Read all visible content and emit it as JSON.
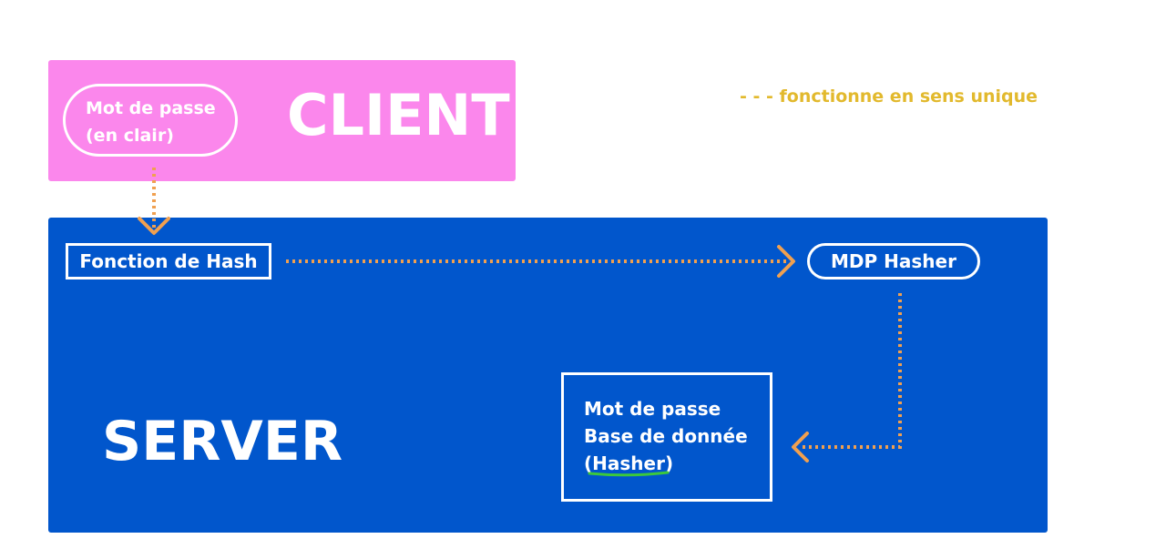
{
  "client": {
    "title": "CLIENT",
    "password_line1": "Mot de passe",
    "password_line2": "(en clair)"
  },
  "server": {
    "title": "SERVER",
    "hash_function": "Fonction de Hash",
    "hashed_password": "MDP Hasher",
    "database_line1": "Mot de passe",
    "database_line2": "Base de donnée",
    "database_line3": "(Hasher)"
  },
  "legend": {
    "text": "- - - fonctionne en sens unique"
  },
  "colors": {
    "client_bg": "#fb87ec",
    "server_bg": "#0156cc",
    "arrow": "#f0a050",
    "legend": "#e2b92d",
    "underline": "#3cc83c"
  }
}
